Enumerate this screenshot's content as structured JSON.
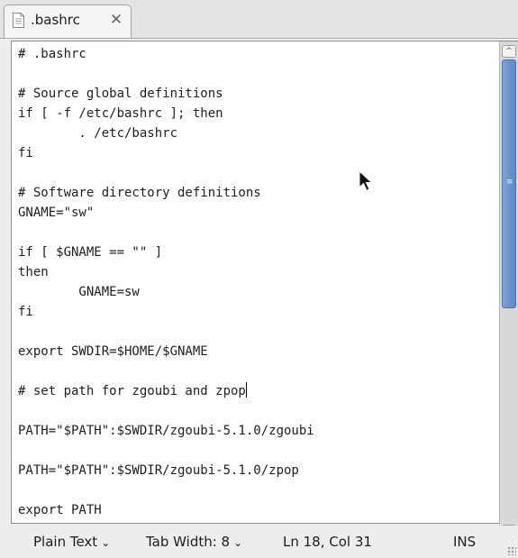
{
  "tab": {
    "title": ".bashrc",
    "close_glyph": "✕",
    "icon": "text-document-icon"
  },
  "editor": {
    "lines": [
      "# .bashrc",
      "",
      "# Source global definitions",
      "if [ -f /etc/bashrc ]; then",
      "        . /etc/bashrc",
      "fi",
      "",
      "# Software directory definitions",
      "GNAME=\"sw\"",
      "",
      "if [ $GNAME == \"\" ]",
      "then",
      "        GNAME=sw",
      "fi",
      "",
      "export SWDIR=$HOME/$GNAME",
      "",
      "# set path for zgoubi and zpop",
      "",
      "PATH=\"$PATH\":$SWDIR/zgoubi-5.1.0/zgoubi",
      "",
      "PATH=\"$PATH\":$SWDIR/zgoubi-5.1.0/zpop",
      "",
      "export PATH"
    ],
    "caret_line": 18,
    "caret_col": 31
  },
  "statusbar": {
    "language": "Plain Text",
    "tab_width": "Tab Width:  8",
    "cursor_position": "Ln 18, Col 31",
    "insert_mode": "INS"
  },
  "scrollbar": {
    "up_glyph": "^",
    "down_glyph": "v",
    "grip_glyph": "≡"
  },
  "colors": {
    "scroll_thumb": "#5b87c7",
    "editor_bg": "#ffffff",
    "chrome_bg": "#ededed"
  }
}
